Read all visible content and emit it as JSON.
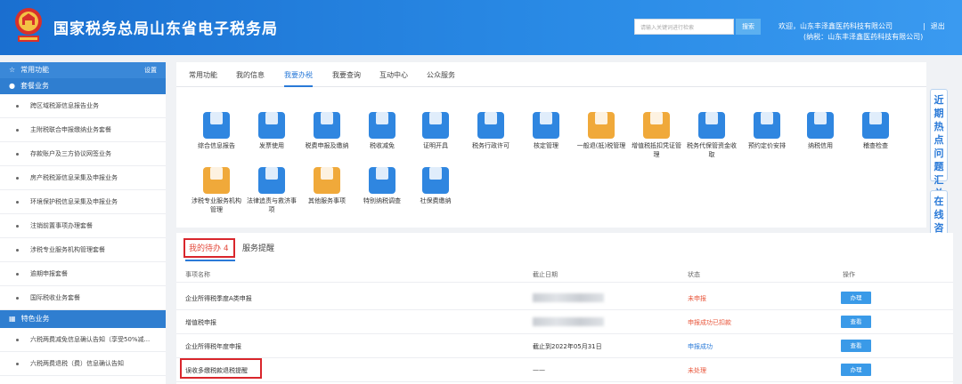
{
  "header": {
    "title": "国家税务总局山东省电子税务局",
    "search_placeholder": "请输入关键词进行检索",
    "search_button": "搜索",
    "welcome": "欢迎，山东丰泽鑫医药科技有限公司",
    "welcome_sub": "(纳税：山东丰泽鑫医药科技有限公司)",
    "separator": "|",
    "logout": "退出"
  },
  "sidebar": {
    "common_label": "常用功能",
    "settings_label": "设置",
    "package_label": "套餐业务",
    "items": [
      "跨区域税源信息报告业务",
      "主附税联合申报缴纳业务套餐",
      "存款账户及三方协议网签业务",
      "房产税税源信息采集及申报业务",
      "环境保护税信息采集及申报业务",
      "注销前置事项办理套餐",
      "涉税专业服务机构管理套餐",
      "逾期申报套餐",
      "国际税收业务套餐"
    ],
    "special_label": "特色业务",
    "special_items": [
      "六税两费减免信息确认告知（享受50%减...",
      "六税两费退税（费）信息确认告知"
    ]
  },
  "nav": {
    "tabs": [
      "常用功能",
      "我的信息",
      "我要办税",
      "我要查询",
      "互动中心",
      "公众服务"
    ],
    "active_index": 2
  },
  "services": [
    {
      "label": "综合信息报告",
      "icon": "document-icon",
      "color": "#2f86e0"
    },
    {
      "label": "发票使用",
      "icon": "invoice-icon",
      "color": "#2f86e0"
    },
    {
      "label": "税费申报及缴纳",
      "icon": "stack-icon",
      "color": "#2f86e0"
    },
    {
      "label": "税收减免",
      "icon": "yen-ticket-icon",
      "color": "#2f86e0"
    },
    {
      "label": "证明开具",
      "icon": "pen-icon",
      "color": "#2f86e0"
    },
    {
      "label": "税务行政许可",
      "icon": "permit-icon",
      "color": "#2f86e0"
    },
    {
      "label": "核定管理",
      "icon": "folder-icon",
      "color": "#2f86e0"
    },
    {
      "label": "一般退(抵)税管理",
      "icon": "handshake-icon",
      "color": "#f0a93a"
    },
    {
      "label": "增值税抵扣凭证管理",
      "icon": "ledger-icon",
      "color": "#f0a93a"
    },
    {
      "label": "税务代保管资金收取",
      "icon": "fund-icon",
      "color": "#2f86e0"
    },
    {
      "label": "预约定价安排",
      "icon": "chart-coin-icon",
      "color": "#2f86e0"
    },
    {
      "label": "纳税信用",
      "icon": "thumb-icon",
      "color": "#2f86e0"
    },
    {
      "label": "稽查检查",
      "icon": "inspect-icon",
      "color": "#2f86e0"
    },
    {
      "label": "涉税专业服务机构管理",
      "icon": "globe-icon",
      "color": "#f0a93a"
    },
    {
      "label": "法律追责与救济事项",
      "icon": "gavel-icon",
      "color": "#2f86e0"
    },
    {
      "label": "其他服务事项",
      "icon": "grid-icon",
      "color": "#f0a93a"
    },
    {
      "label": "特别纳税调查",
      "icon": "bars-icon",
      "color": "#2f86e0"
    },
    {
      "label": "社保费缴纳",
      "icon": "hands-icon",
      "color": "#2f86e0"
    }
  ],
  "float_buttons": {
    "faq": "近期热点问题汇总",
    "consult": "在线咨询"
  },
  "tasks": {
    "tab_pending": "我的待办 4",
    "tab_reminder": "服务提醒",
    "columns": [
      "事项名称",
      "截止日期",
      "状态",
      "操作"
    ],
    "rows": [
      {
        "name": "企业所得税季度A类申报",
        "deadline": "",
        "status": "未申报",
        "status_type": "red",
        "action": "办理"
      },
      {
        "name": "增值税申报",
        "deadline": "",
        "status": "申报成功已扣款",
        "status_type": "red",
        "action": "查看"
      },
      {
        "name": "企业所得税年度申报",
        "deadline": "截止到2022年05月31日",
        "status": "申报成功",
        "status_type": "blue",
        "action": "查看"
      },
      {
        "name": "误收多缴税款退税提醒",
        "deadline": "——",
        "status": "未处理",
        "status_type": "red",
        "action": "办理"
      }
    ]
  }
}
